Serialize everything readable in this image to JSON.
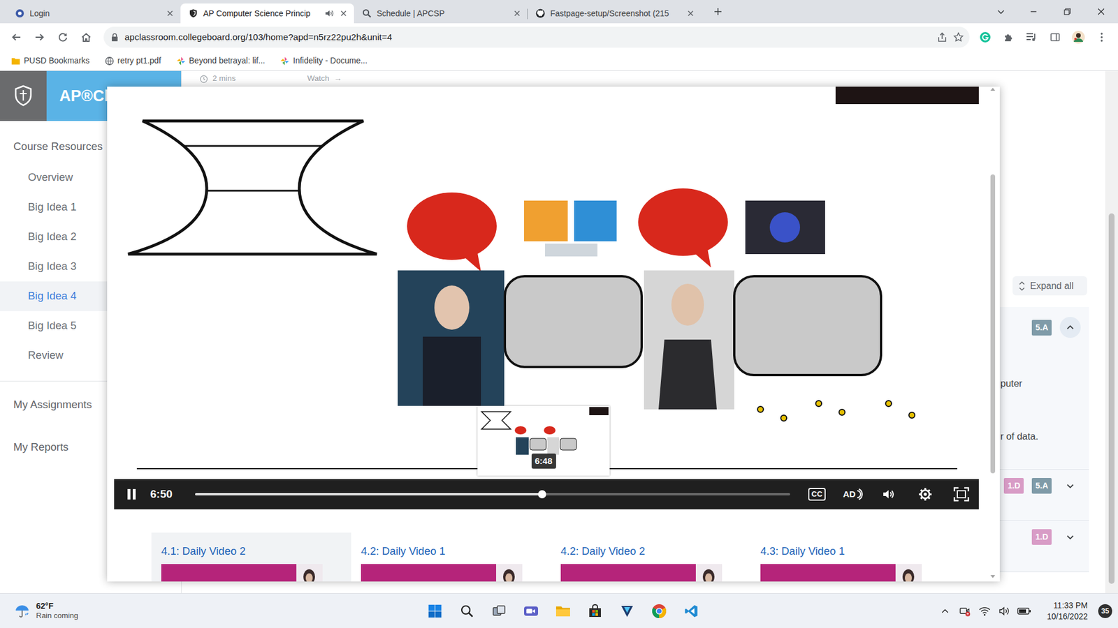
{
  "browser": {
    "tabs": [
      {
        "label": "Login",
        "selected": false,
        "audio": false
      },
      {
        "label": "AP Computer Science Princip",
        "selected": true,
        "audio": true
      },
      {
        "label": "Schedule | APCSP",
        "selected": false,
        "audio": false
      },
      {
        "label": "Fastpage-setup/Screenshot (215",
        "selected": false,
        "audio": false
      }
    ],
    "address": "apclassroom.collegeboard.org/103/home?apd=n5rz22pu2h&unit=4",
    "bookmarks": [
      {
        "label": "PUSD Bookmarks",
        "kind": "folder"
      },
      {
        "label": "retry pt1.pdf",
        "kind": "globe"
      },
      {
        "label": "Beyond betrayal: lif...",
        "kind": "doc"
      },
      {
        "label": "Infidelity - Docume...",
        "kind": "doc"
      }
    ]
  },
  "app": {
    "brand": "AP®Cla",
    "clip": {
      "duration": "2 mins",
      "watch": "Watch",
      "arrow": "→"
    }
  },
  "sidebar": {
    "heading": "Course Resources",
    "items": [
      {
        "label": "Overview",
        "selected": false
      },
      {
        "label": "Big Idea 1",
        "selected": false
      },
      {
        "label": "Big Idea 2",
        "selected": false
      },
      {
        "label": "Big Idea 3",
        "selected": false
      },
      {
        "label": "Big Idea 4",
        "selected": true
      },
      {
        "label": "Big Idea 5",
        "selected": false
      },
      {
        "label": "Review",
        "selected": false
      }
    ],
    "links": [
      "My Assignments",
      "My Reports"
    ]
  },
  "right_panel": {
    "expand": "Expand all",
    "rows": [
      {
        "badges": [
          {
            "label": "5.A",
            "color": "#7f9ba8"
          }
        ],
        "expanded": true,
        "lines": [
          "puter",
          "r of data."
        ]
      },
      {
        "badges": [
          {
            "label": "1.D",
            "color": "#d89cc6"
          },
          {
            "label": "5.A",
            "color": "#7f9ba8"
          }
        ],
        "expanded": false,
        "lines": []
      },
      {
        "badges": [
          {
            "label": "1.D",
            "color": "#d89cc6"
          }
        ],
        "expanded": false,
        "lines": []
      }
    ]
  },
  "video": {
    "playing": true,
    "time": "6:50",
    "level": 0.583,
    "preview_time": "6:48",
    "captions": "CC",
    "audio_description": "AD"
  },
  "playlist": [
    {
      "title": "4.1: Daily Video 2",
      "selected": true
    },
    {
      "title": "4.2: Daily Video 1",
      "selected": false
    },
    {
      "title": "4.2: Daily Video 2",
      "selected": false
    },
    {
      "title": "4.3: Daily Video 1",
      "selected": false
    }
  ],
  "taskbar": {
    "weather": {
      "temp": "62°F",
      "forecast": "Rain coming"
    },
    "time": "11:33 PM",
    "date": "10/16/2022",
    "notifications": "35"
  }
}
